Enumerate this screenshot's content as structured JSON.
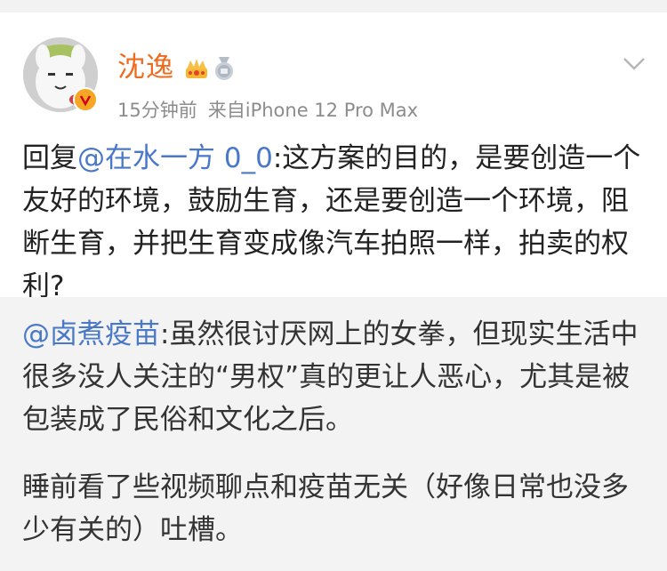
{
  "post": {
    "author": "沈逸",
    "timestamp": "15分钟前",
    "source": "来自iPhone 12 Pro Max",
    "reply_prefix": "回复",
    "reply_mention": "@在水一方 0_0",
    "body": ":这方案的目的，是要创造一个友好的环境，鼓励生育，还是要创造一个环境，阻断生育，并把生育变成像汽车拍照一样，拍卖的权利?"
  },
  "repost": {
    "mention": "@卤煮疫苗",
    "body": ":虽然很讨厌网上的女拳，但现实生活中很多没人关注的“男权”真的更让人恶心，尤其是被包装成了民俗和文化之后。",
    "extra": "睡前看了些视频聊点和疫苗无关（好像日常也没多少有关的）吐槽。"
  },
  "colors": {
    "username": "#ef6a1c",
    "mention": "#4a78c8",
    "meta": "#8c8c8c",
    "repost_bg": "#f3f3f3"
  },
  "icons": [
    "avatar",
    "verified-badge-icon",
    "crown-icon",
    "medal-icon",
    "chevron-down-icon"
  ]
}
